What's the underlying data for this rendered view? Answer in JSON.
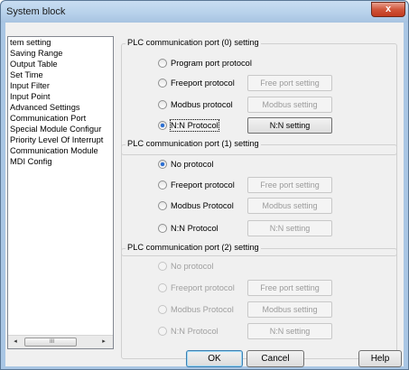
{
  "window": {
    "title": "System block",
    "close_glyph": "x"
  },
  "sidebar": {
    "items": [
      "tem setting",
      "Saving Range",
      "Output Table",
      "Set Time",
      "Input Filter",
      "Input Point",
      "Advanced Settings",
      "Communication Port",
      "Special Module Configur",
      "Priority Level Of Interrupt",
      "Communication Module",
      "MDI Config"
    ],
    "scrollbar": {
      "left_arrow": "◂",
      "right_arrow": "▸",
      "grip": "III"
    }
  },
  "port0": {
    "title": "PLC communication port (0) setting",
    "options": {
      "program": "Program port protocol",
      "freeport": "Freeport protocol",
      "modbus": "Modbus protocol",
      "nn": "N:N Protocol"
    },
    "selected": "N:N Protocol",
    "buttons": {
      "free": "Free port setting",
      "modbus": "Modbus setting",
      "nn": "N:N setting"
    }
  },
  "port1": {
    "title": "PLC communication port (1) setting",
    "options": {
      "none": "No protocol",
      "freeport": "Freeport protocol",
      "modbus": "Modbus Protocol",
      "nn": "N:N Protocol"
    },
    "selected": "No protocol",
    "buttons": {
      "free": "Free port setting",
      "modbus": "Modbus setting",
      "nn": "N:N setting"
    }
  },
  "port2": {
    "title": "PLC communication port (2) setting",
    "options": {
      "none": "No protocol",
      "freeport": "Freeport protocol",
      "modbus": "Modbus Protocol",
      "nn": "N:N Protocol"
    },
    "buttons": {
      "free": "Free port setting",
      "modbus": "Modbus setting",
      "nn": "N:N setting"
    }
  },
  "footer": {
    "ok": "OK",
    "cancel": "Cancel",
    "help": "Help"
  },
  "colors": {
    "accent": "#2a6fd4",
    "title_bar": "#b6d0ea",
    "close_button": "#c23a1f"
  }
}
